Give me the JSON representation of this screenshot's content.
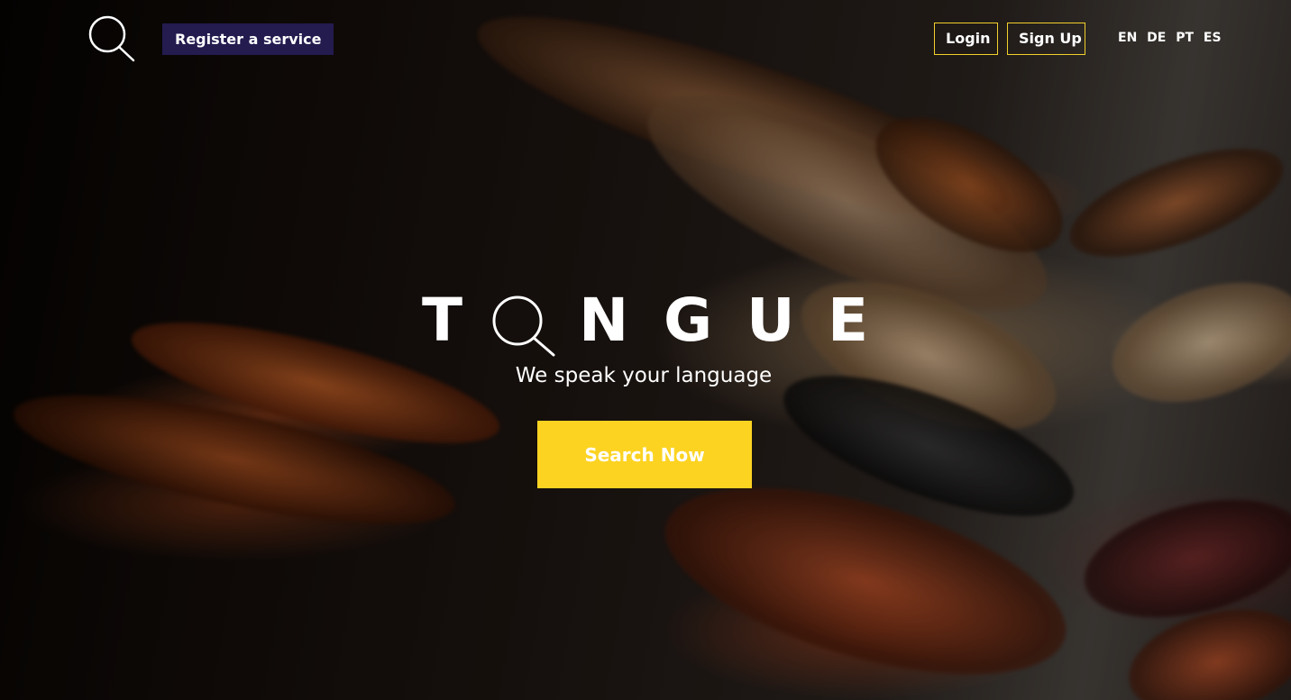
{
  "header": {
    "logo_icon": "magnifier-icon",
    "register_label": "Register a service",
    "login_label": "Login",
    "signup_label": "Sign Up",
    "languages": [
      "EN",
      "DE",
      "PT",
      "ES"
    ]
  },
  "hero": {
    "title_letters": [
      "T",
      "G",
      "N",
      "G",
      "U",
      "E"
    ],
    "title_o_icon": "magnifier-icon",
    "title_t": "T",
    "title_n": "N",
    "title_g": "G",
    "title_u": "U",
    "title_e": "E",
    "tagline": "We speak your language",
    "cta_label": "Search Now"
  },
  "colors": {
    "accent_yellow": "#fcd321",
    "register_bg": "#241b4f",
    "button_border": "#f2cf2b"
  }
}
